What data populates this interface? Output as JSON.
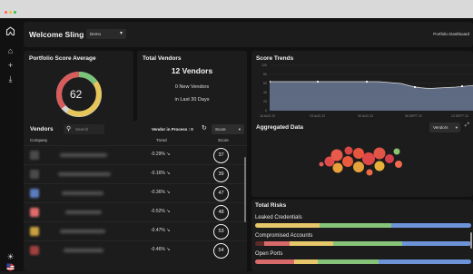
{
  "window": {
    "dots": [
      "#ff5f57",
      "#febc2e",
      "#28c840"
    ]
  },
  "header": {
    "title": "Welcome Sling",
    "dropdown": "Demo",
    "portfolio_dashboard": "Portfolio Dashboard"
  },
  "portfolio_score": {
    "title": "Portfolio Score Average",
    "value": "62"
  },
  "total_vendors": {
    "title": "Total Vendors",
    "count": "12 Vendors",
    "new_vendors": "0 New Vendors",
    "period": "in Last 30 Days"
  },
  "score_trends": {
    "title": "Score Trends",
    "y_ticks": [
      "100",
      "80",
      "60",
      "40",
      "20",
      "0"
    ],
    "x_ticks": [
      "16 AUG 22",
      "23 AUG 22",
      "30 AUG 22",
      "06 SEPT 22",
      "13 SEPT 22"
    ]
  },
  "vendors": {
    "title": "Vendors",
    "search_placeholder": "Search",
    "in_process": "Vendor in Process : 0",
    "sort": "Score",
    "col_company": "Company",
    "col_trend": "Trend",
    "col_score": "Score",
    "rows": [
      {
        "trend": "-0.29% ↘",
        "score": "37",
        "color": "#3a3a3a"
      },
      {
        "trend": "-0.16% ↘",
        "score": "39",
        "color": "#3a3a3a"
      },
      {
        "trend": "-0.36% ↘",
        "score": "47",
        "color": "#5b7dc0"
      },
      {
        "trend": "-0.52% ↘",
        "score": "48",
        "color": "#e06a6a"
      },
      {
        "trend": "-0.47% ↘",
        "score": "53",
        "color": "#c8a040"
      },
      {
        "trend": "-0.46% ↘",
        "score": "54",
        "color": "#a04040"
      }
    ]
  },
  "aggregated": {
    "title": "Aggregated Data",
    "filter": "Vendors"
  },
  "risks": {
    "title": "Total Risks",
    "items": [
      {
        "label": "Leaked Credentials"
      },
      {
        "label": "Compromised Accounts"
      },
      {
        "label": "Open Ports"
      }
    ]
  }
}
